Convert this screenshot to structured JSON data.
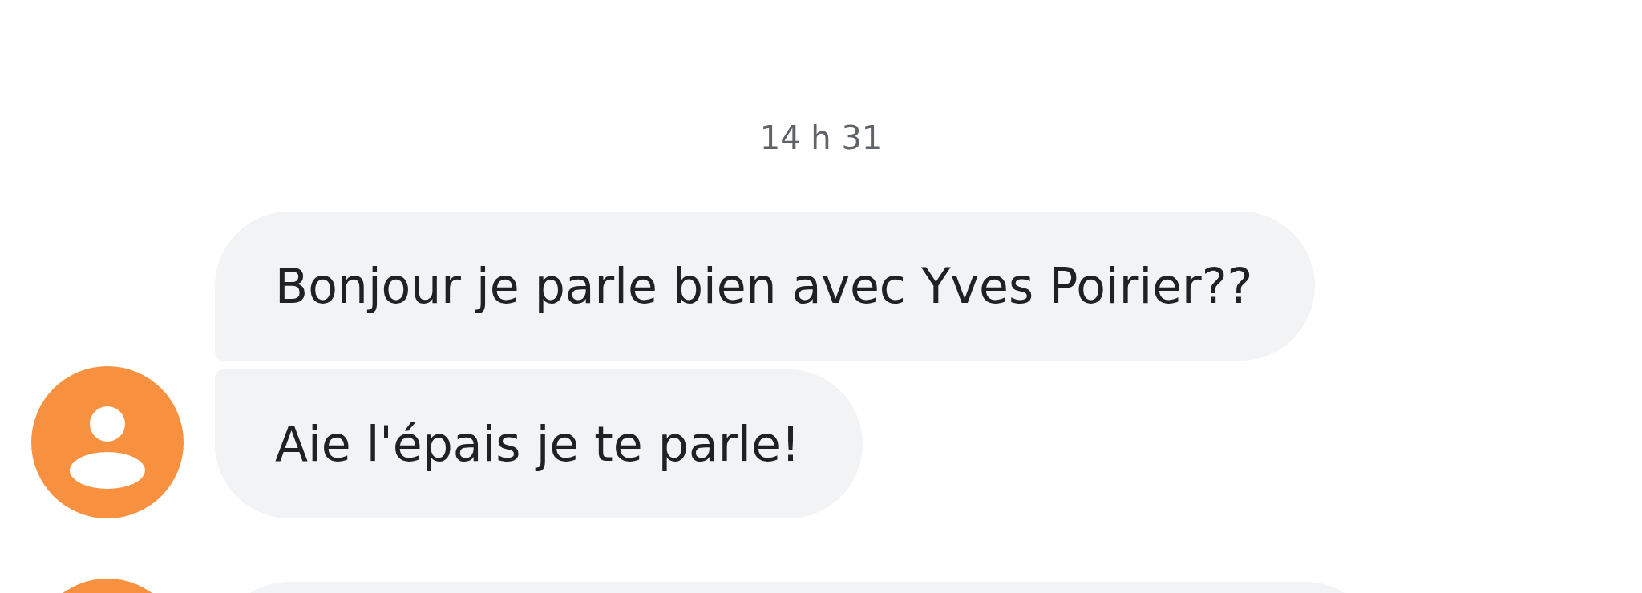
{
  "timestamp": "14 h 31",
  "groups": [
    {
      "color": "#f8913f",
      "messages": [
        {
          "text": "Bonjour je parle bien avec Yves Poirier??"
        },
        {
          "text": "Aie l'épais je te parle!"
        }
      ]
    },
    {
      "color": "#f8913f"
    }
  ]
}
